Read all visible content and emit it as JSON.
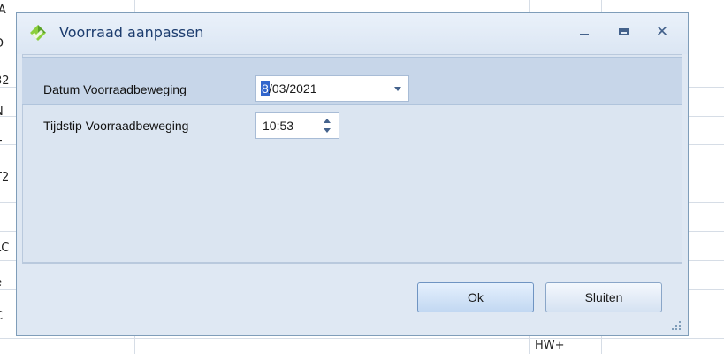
{
  "dialog": {
    "title": "Voorraad aanpassen",
    "window_controls": {
      "minimize": "minimize-icon",
      "maximize": "maximize-icon",
      "close": "close-icon"
    },
    "fields": {
      "date_label": "Datum Voorraadbeweging",
      "date_selected_part": "8",
      "date_rest": "/03/2021",
      "time_label": "Tijdstip Voorraadbeweging",
      "time_value": "10:53"
    },
    "buttons": {
      "ok": "Ok",
      "close": "Sluiten"
    }
  },
  "background": {
    "left_fragments": [
      "IA",
      "D",
      "32",
      "N",
      "T",
      "T2",
      "LC",
      "e",
      "C"
    ],
    "bottom_cell": "HW+"
  },
  "colors": {
    "accent": "#3366cc",
    "title_text": "#1c3c6e",
    "dialog_bg": "#dfe8f3"
  }
}
